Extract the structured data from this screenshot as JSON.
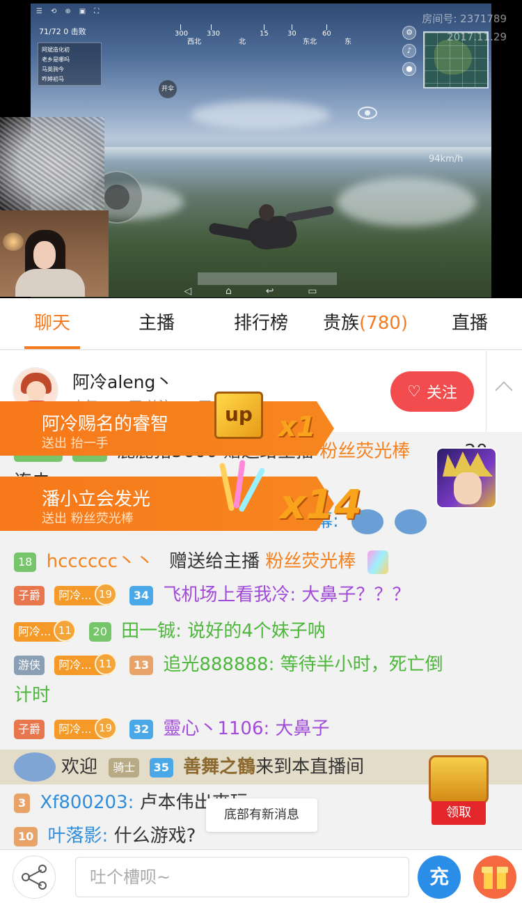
{
  "video": {
    "room_label": "房间号: 2371789",
    "date": "2017.11.29",
    "hud_toolbar": [
      "☰",
      "⟲",
      "⊕",
      "▣",
      "⛶"
    ],
    "players_alive": "71/72",
    "kills": "0 击败",
    "compass_labels": [
      "300",
      "西北",
      "330",
      "北",
      "15",
      "30",
      "东北",
      "60",
      "东"
    ],
    "team_panel": [
      "阿斌造化初",
      "老乡是哪吗",
      "马英驹今",
      "咋婷初马"
    ],
    "parachute_label": "开伞",
    "speed": "94km/h"
  },
  "tabs": [
    {
      "label": "聊天",
      "active": true
    },
    {
      "label": "主播",
      "active": false
    },
    {
      "label": "排行榜",
      "active": false
    },
    {
      "label": "贵族",
      "count": "(780)",
      "active": false
    },
    {
      "label": "直播",
      "active": false
    }
  ],
  "anchor": {
    "name": "阿冷aleng丶",
    "stats": "人气 47.9万    关注 147万",
    "follow_label": "关注"
  },
  "gift_banners": [
    {
      "title": "阿冷赐名的睿智",
      "sub": "送出 抬一手",
      "icon_text": "up",
      "multiplier": "x1"
    },
    {
      "title": "潘小立会发光",
      "sub": "送出 粉丝荧光棒",
      "multiplier": "x14"
    }
  ],
  "chat": {
    "partial_1": {
      "level": "25",
      "text": "鹿鹿猪5600  赠送给主播",
      "gift": "粉丝荧光棒",
      "count": "20"
    },
    "partial_1_tail": "连击",
    "partial_2_tail": "幕:",
    "msg_1": {
      "level": "18",
      "nick": "hcccccc丶丶",
      "action": "赠送给主播",
      "gift": "粉丝荧光棒"
    },
    "msg_2": {
      "noble": "子爵",
      "fan": "阿冷...",
      "fan_lv": "19",
      "level": "34",
      "nick": "飞机场上看我冷:",
      "text": "大鼻子？？？"
    },
    "msg_3": {
      "fan": "阿冷...",
      "fan_lv": "11",
      "level": "20",
      "nick": "田一铖:",
      "text": "说好的4个妹子呐"
    },
    "msg_4": {
      "noble": "游侠",
      "fan": "阿冷...",
      "fan_lv": "11",
      "level": "13",
      "nick": "追光888888:",
      "text": "等待半小时，死亡倒",
      "text_2": "计时"
    },
    "msg_5": {
      "noble": "子爵",
      "fan": "阿冷...",
      "fan_lv": "19",
      "level": "32",
      "nick": "靈心丶1106:",
      "text": "大鼻子"
    },
    "welcome": {
      "prefix": "欢迎",
      "noble": "骑士",
      "level": "35",
      "name": "善舞之鶴",
      "suffix": "来到本直播间"
    },
    "msg_6": {
      "level": "3",
      "nick": "Xf800203:",
      "text": "卢本伟出來玩"
    },
    "msg_7": {
      "level": "10",
      "nick": "叶落影:",
      "text": "什么游戏?"
    },
    "new_msg_tip": "底部有新消息",
    "treasure_claim": "领取"
  },
  "bottom": {
    "input_placeholder": "吐个槽呗~",
    "recharge_label": "充"
  }
}
